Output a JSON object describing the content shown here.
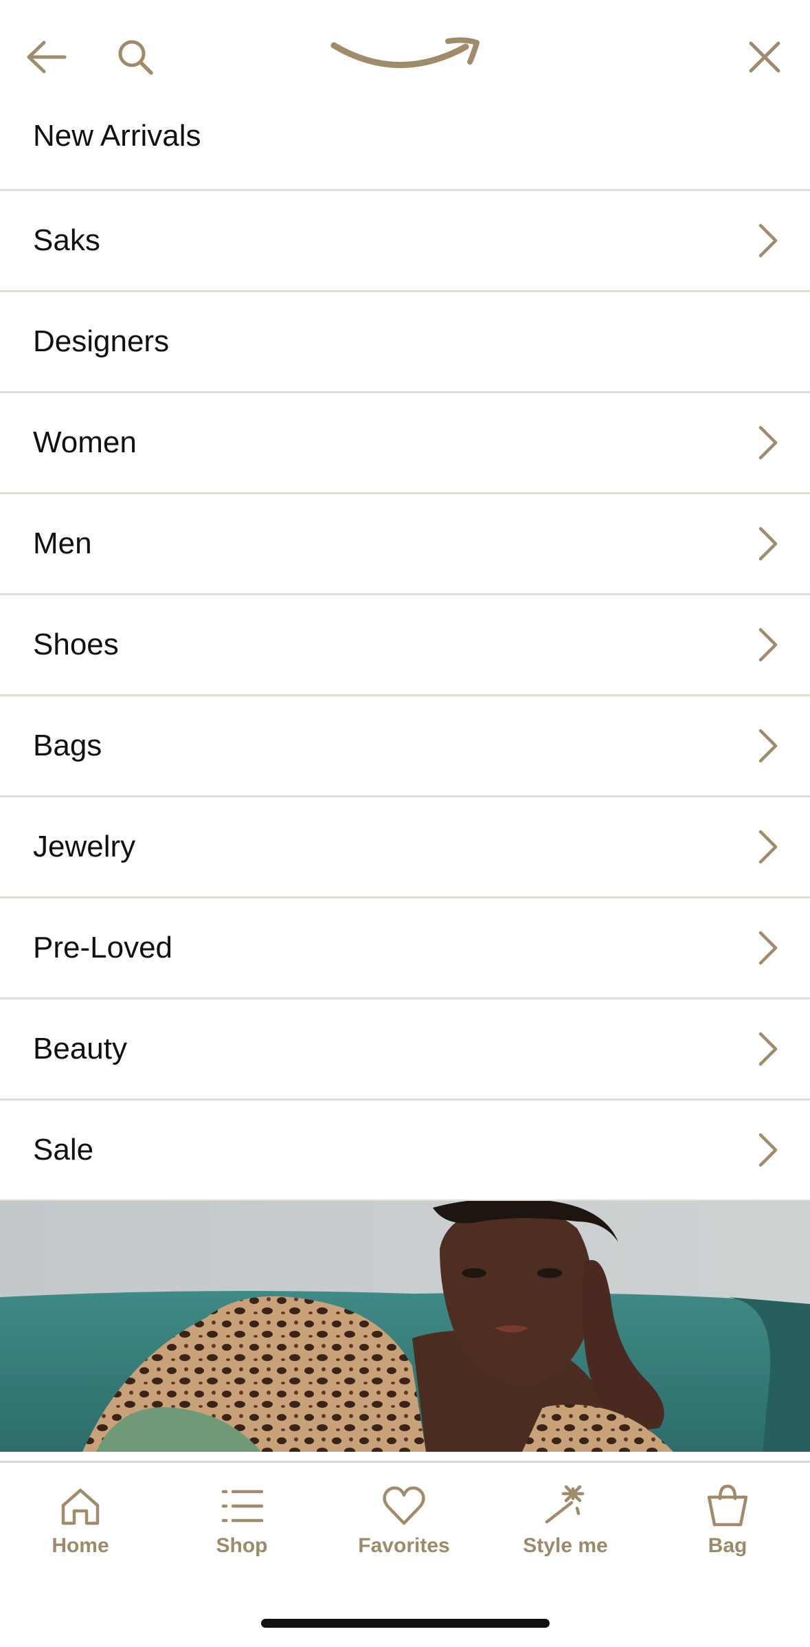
{
  "colors": {
    "accent": "#a08c6a",
    "divider": "#e1ddd5",
    "text": "#111111"
  },
  "topbar": {
    "back_icon": "arrow-left-icon",
    "search_icon": "search-icon",
    "logo": "smile-arrow-logo",
    "close_icon": "close-icon"
  },
  "menu": {
    "items": [
      {
        "label": "New Arrivals",
        "chevron": false
      },
      {
        "label": "Saks",
        "chevron": true
      },
      {
        "label": "Designers",
        "chevron": false
      },
      {
        "label": "Women",
        "chevron": true
      },
      {
        "label": "Men",
        "chevron": true
      },
      {
        "label": "Shoes",
        "chevron": true
      },
      {
        "label": "Bags",
        "chevron": true
      },
      {
        "label": "Jewelry",
        "chevron": true
      },
      {
        "label": "Pre-Loved",
        "chevron": true
      },
      {
        "label": "Beauty",
        "chevron": true
      },
      {
        "label": "Sale",
        "chevron": true
      }
    ]
  },
  "tabbar": {
    "tabs": [
      {
        "label": "Home",
        "icon": "home-icon"
      },
      {
        "label": "Shop",
        "icon": "list-icon"
      },
      {
        "label": "Favorites",
        "icon": "heart-icon"
      },
      {
        "label": "Style me",
        "icon": "magic-wand-icon"
      },
      {
        "label": "Bag",
        "icon": "shopping-bag-icon"
      }
    ]
  }
}
